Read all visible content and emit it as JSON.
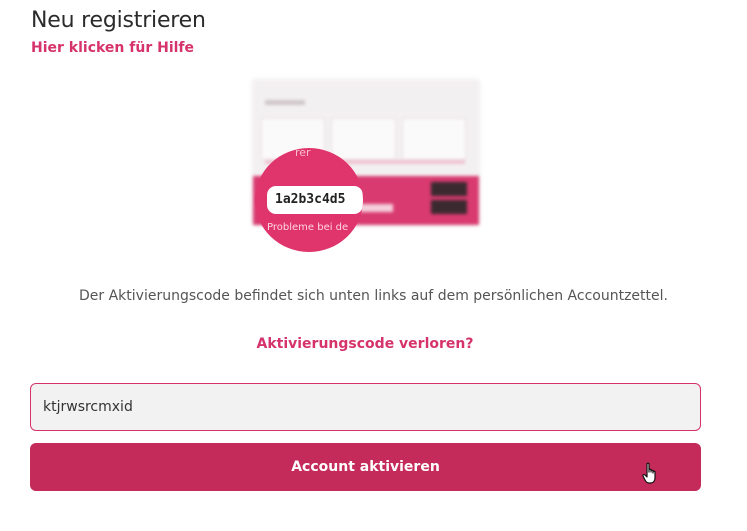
{
  "header": {
    "title": "Neu registrieren",
    "help_link": "Hier klicken für Hilfe"
  },
  "illustration": {
    "code": "1a2b3c4d5",
    "problem_text": "Probleme bei de",
    "top_text": "rer"
  },
  "info": {
    "text": "Der Aktivierungscode befindet sich unten links auf dem persönlichen Accountzettel.",
    "lost_link": "Aktivierungscode verloren?"
  },
  "form": {
    "code_value": "ktjrwsrcmxid",
    "submit_label": "Account aktivieren"
  },
  "colors": {
    "accent": "#d6336c",
    "button": "#c42b5a"
  },
  "icons": {
    "cursor": "hand-pointer-icon"
  }
}
